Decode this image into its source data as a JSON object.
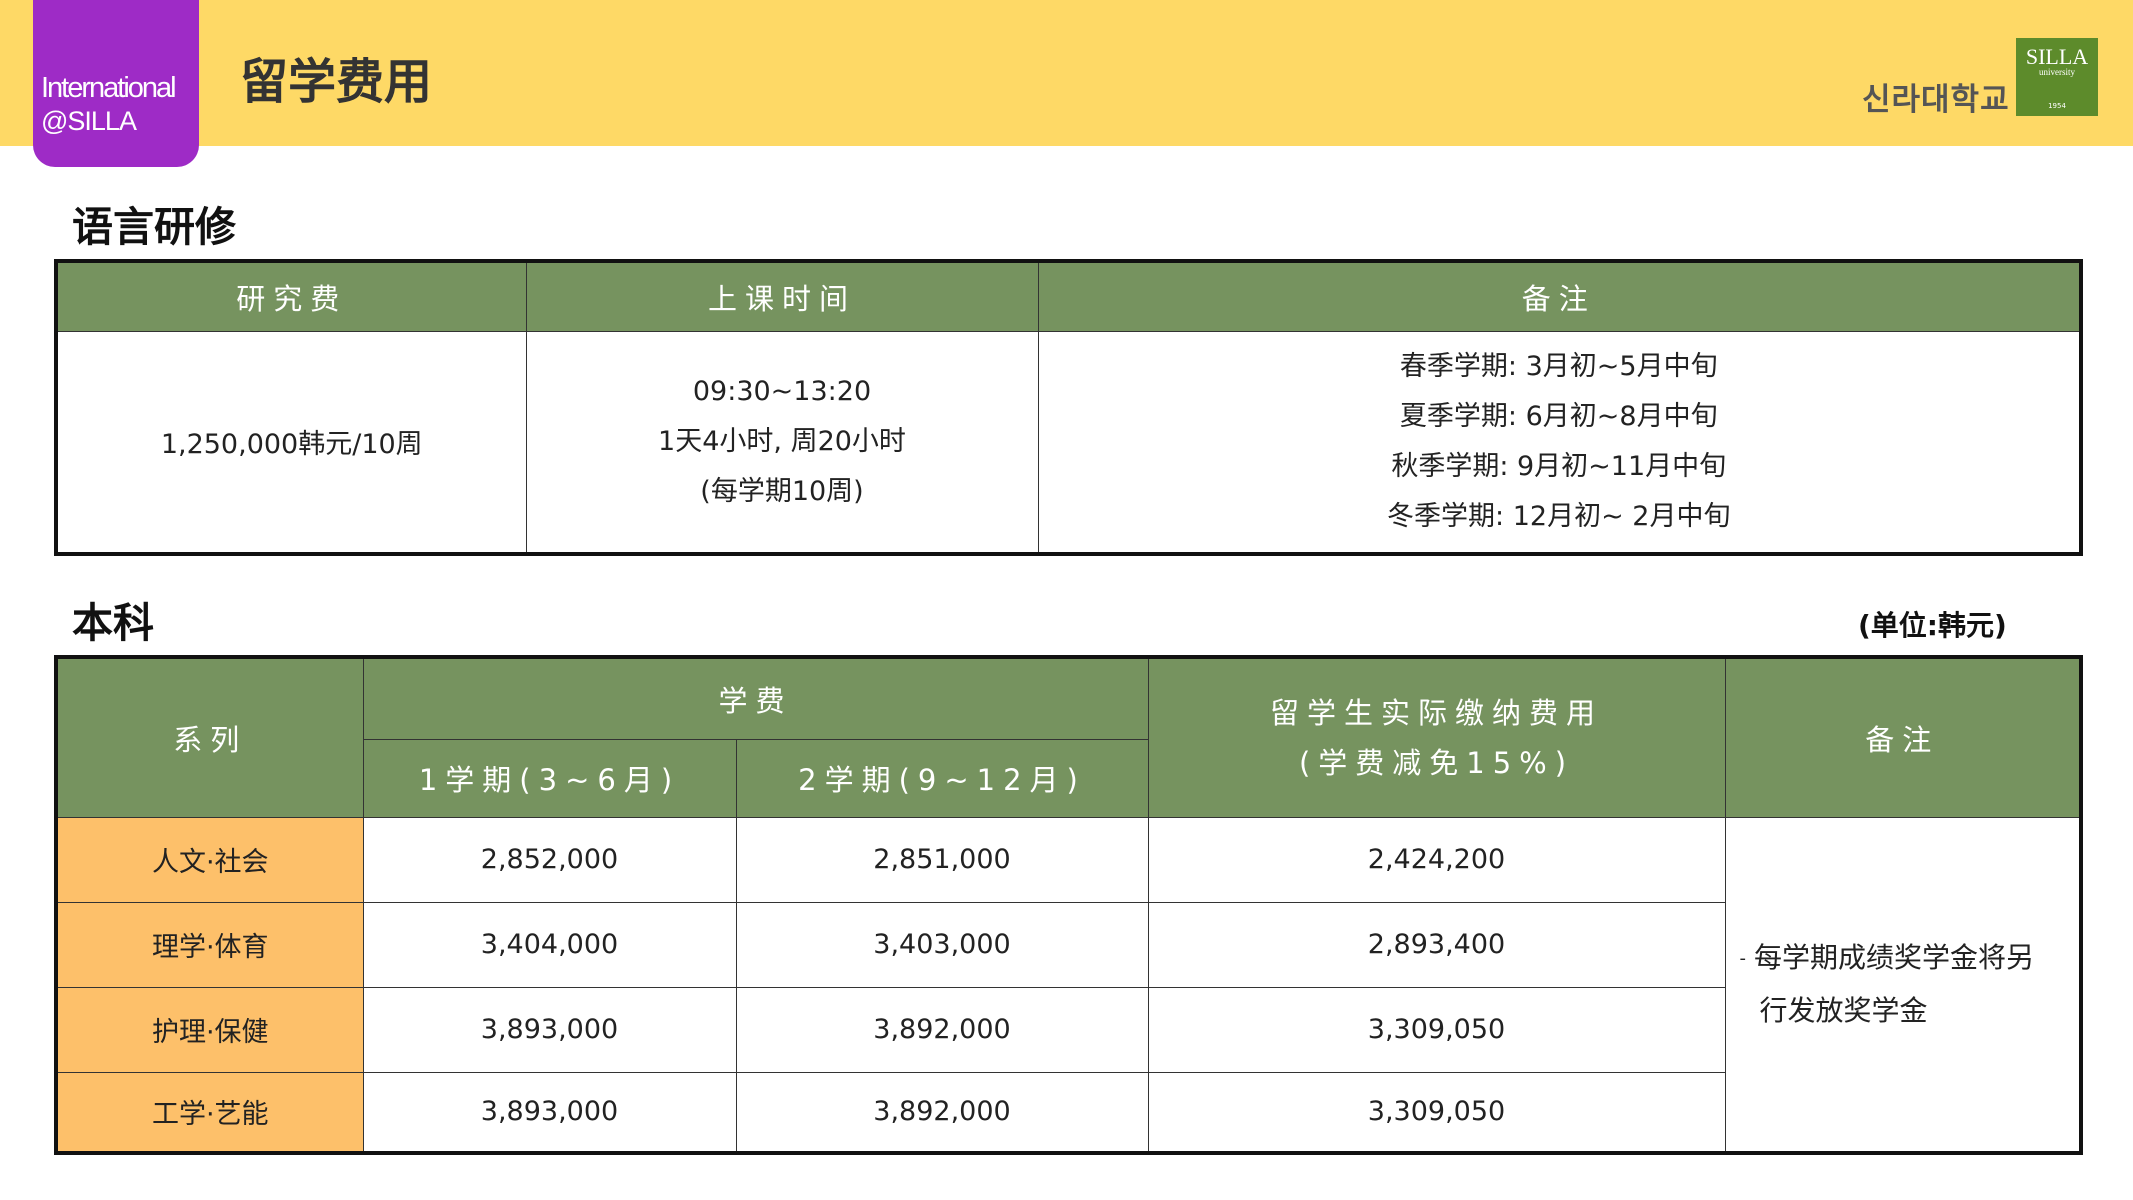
{
  "header": {
    "badge_line1": "International",
    "badge_line2": "@SILLA",
    "title": "留学费用",
    "university_name": "신라대학교",
    "logo_text": "SILLA",
    "logo_sub": "university",
    "logo_year": "1954"
  },
  "language": {
    "title": "语言研修",
    "headers": [
      "研究费",
      "上课时间",
      "备注"
    ],
    "fee": "1,250,000韩元/10周",
    "schedule": [
      "09:30~13:20",
      "1天4小时, 周20小时",
      "(每学期10周)"
    ],
    "notes": [
      "春季学期: 3月初~5月中旬",
      "夏季学期: 6月初~8月中旬",
      "秋季学期: 9月初~11月中旬",
      "冬季学期: 12月初~ 2月中旬"
    ]
  },
  "undergrad": {
    "title": "本科",
    "unit": "(单位:韩元)",
    "headers": {
      "dept": "系列",
      "tuition": "学费",
      "sem1": "1学期(3~6月)",
      "sem2": "2学期(9~12月)",
      "actual_line1": "留学生实际缴纳费用",
      "actual_line2": "(学费减免15%)",
      "note": "备注"
    },
    "rows": [
      {
        "dept": "人文·社会",
        "sem1": "2,852,000",
        "sem2": "2,851,000",
        "actual": "2,424,200"
      },
      {
        "dept": "理学·体育",
        "sem1": "3,404,000",
        "sem2": "3,403,000",
        "actual": "2,893,400"
      },
      {
        "dept": "护理·保健",
        "sem1": "3,893,000",
        "sem2": "3,892,000",
        "actual": "3,309,050"
      },
      {
        "dept": "工学·艺能",
        "sem1": "3,893,000",
        "sem2": "3,892,000",
        "actual": "3,309,050"
      }
    ],
    "note_dash": "-",
    "note_line1": "每学期成绩奖学金将另",
    "note_line2": "行发放奖学金"
  }
}
